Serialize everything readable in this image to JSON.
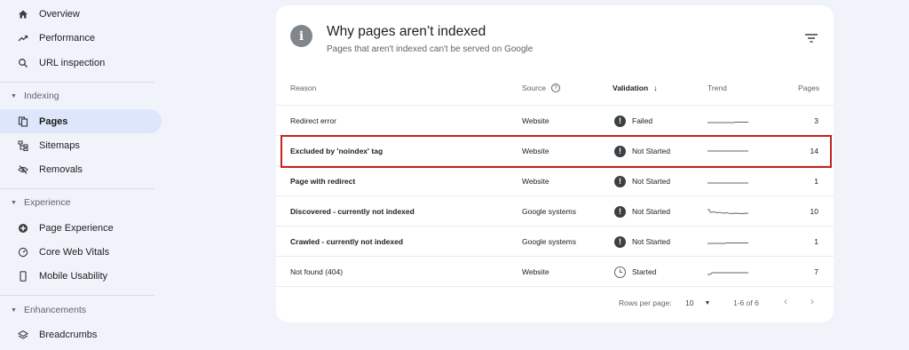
{
  "sidebar": {
    "items": [
      {
        "label": "Overview",
        "icon": "home-icon"
      },
      {
        "label": "Performance",
        "icon": "trending-up-icon"
      },
      {
        "label": "URL inspection",
        "icon": "search-icon"
      },
      {
        "label": "Pages",
        "icon": "pages-icon",
        "active": true
      },
      {
        "label": "Sitemaps",
        "icon": "sitemap-icon"
      },
      {
        "label": "Removals",
        "icon": "eye-off-icon"
      },
      {
        "label": "Page Experience",
        "icon": "plus-circle-icon"
      },
      {
        "label": "Core Web Vitals",
        "icon": "gauge-icon"
      },
      {
        "label": "Mobile Usability",
        "icon": "phone-icon"
      },
      {
        "label": "Breadcrumbs",
        "icon": "layers-icon"
      }
    ],
    "sections": [
      "Indexing",
      "Experience",
      "Enhancements"
    ]
  },
  "card": {
    "title": "Why pages aren’t indexed",
    "subtitle": "Pages that aren't indexed can't be served on Google"
  },
  "table": {
    "headers": {
      "reason": "Reason",
      "source": "Source",
      "validation": "Validation",
      "trend": "Trend",
      "pages": "Pages"
    },
    "rows": [
      {
        "reason": "Redirect error",
        "source": "Website",
        "validation": "Failed",
        "pages": "3"
      },
      {
        "reason": "Excluded by 'noindex' tag",
        "source": "Website",
        "validation": "Not Started",
        "pages": "14"
      },
      {
        "reason": "Page with redirect",
        "source": "Website",
        "validation": "Not Started",
        "pages": "1"
      },
      {
        "reason": "Discovered - currently not indexed",
        "source": "Google systems",
        "validation": "Not Started",
        "pages": "10"
      },
      {
        "reason": "Crawled - currently not indexed",
        "source": "Google systems",
        "validation": "Not Started",
        "pages": "1"
      },
      {
        "reason": "Not found (404)",
        "source": "Website",
        "validation": "Started",
        "pages": "7"
      }
    ]
  },
  "pagination": {
    "rows_per_page_label": "Rows per page:",
    "rows_per_page_value": "10",
    "range": "1-6 of 6"
  },
  "colors": {
    "highlight": "#c5221f",
    "active_bg": "#dde6fb"
  }
}
